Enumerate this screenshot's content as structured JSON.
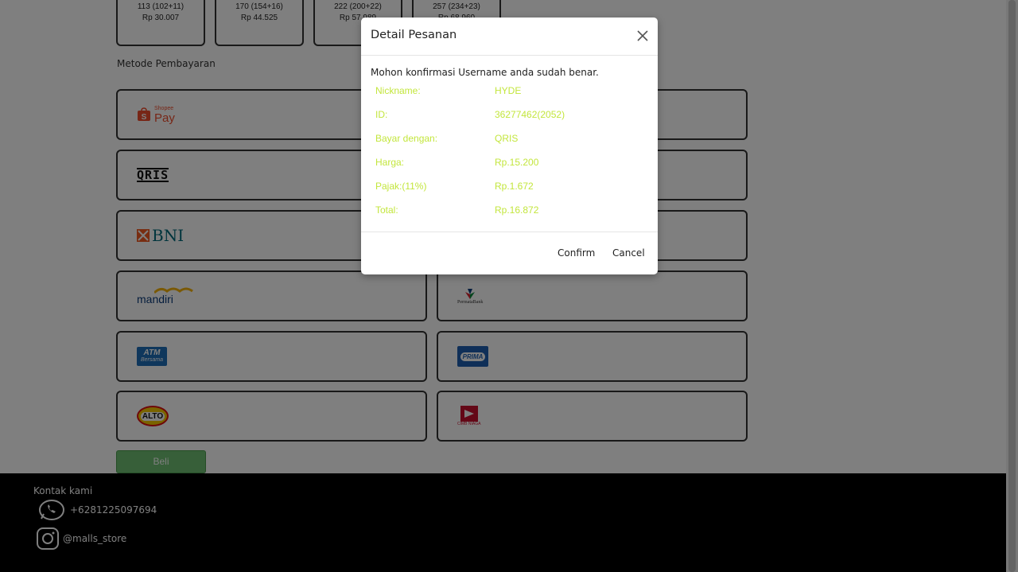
{
  "nominals": [
    {
      "qty": "113 (102+11)",
      "price": "Rp 30.007"
    },
    {
      "qty": "170 (154+16)",
      "price": "Rp 44.525"
    },
    {
      "qty": "222 (200+22)",
      "price": "Rp 57.989"
    },
    {
      "qty": "257 (234+23)",
      "price": "Rp 68.960"
    }
  ],
  "payment": {
    "section_label": "Metode Pembayaran",
    "methods": [
      {
        "name": "ShopeePay",
        "logo_text": "Pay",
        "logo_small": "Shopee"
      },
      {
        "name": "QRIS",
        "logo_text": "QRIS"
      },
      {
        "name": "BNI",
        "logo_text": "BNI"
      },
      {
        "name": "Mandiri",
        "logo_text": "mandiri"
      },
      {
        "name": "PermataBank",
        "logo_text": "PermataBank"
      },
      {
        "name": "ATM Bersama",
        "logo_text": "ATM",
        "logo_small": "Bersama"
      },
      {
        "name": "Prima",
        "logo_text": "PRIMA"
      },
      {
        "name": "Alto",
        "logo_text": "ALTO"
      },
      {
        "name": "CIMB Niaga",
        "logo_text": "CIMB NIAGA"
      }
    ],
    "buy_label": "Beli"
  },
  "footer": {
    "title": "Kontak kami",
    "whatsapp": "+6281225097694",
    "instagram": "@malls_store"
  },
  "modal": {
    "title": "Detail Pesanan",
    "message": "Mohon konfirmasi Username anda sudah benar.",
    "rows": [
      {
        "label": "Nickname:",
        "value": "HYDE"
      },
      {
        "label": "ID:",
        "value": "36277462(2052)"
      },
      {
        "label": "Bayar dengan:",
        "value": "QRIS"
      },
      {
        "label": "Harga:",
        "value": "Rp.15.200"
      },
      {
        "label": "Pajak:(11%)",
        "value": "Rp.1.672"
      },
      {
        "label": "Total:",
        "value": "Rp.16.872"
      }
    ],
    "confirm_label": "Confirm",
    "cancel_label": "Cancel"
  },
  "colors": {
    "detail_text": "#c3e63d",
    "buy_button": "#6fbf73",
    "footer_bg": "#000000"
  }
}
